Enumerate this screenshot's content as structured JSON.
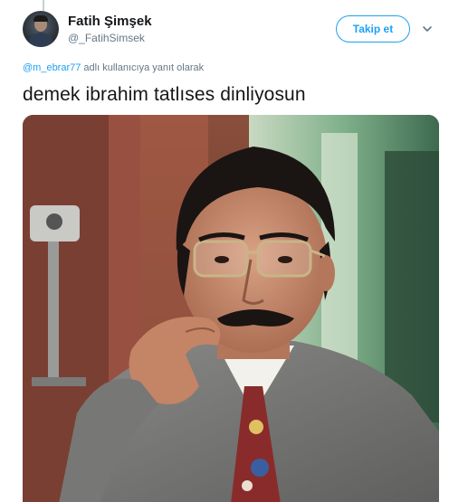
{
  "tweet": {
    "author": {
      "name": "Fatih Şimşek",
      "handle": "@_FatihSimsek",
      "avatar_icon": "avatar-photo-icon"
    },
    "follow_label": "Takip et",
    "menu_icon": "chevron-down-icon",
    "reply_to": {
      "mention": "@m_ebrar77",
      "suffix": " adlı kullanıcıya yanıt olarak"
    },
    "text": "demek ibrahim tatlıses dinliyosun",
    "media": {
      "type": "photo",
      "description_icon": "photo-man-with-glasses-icon"
    }
  },
  "colors": {
    "accent": "#1da1f2",
    "text_primary": "#14171a",
    "text_secondary": "#657786"
  }
}
